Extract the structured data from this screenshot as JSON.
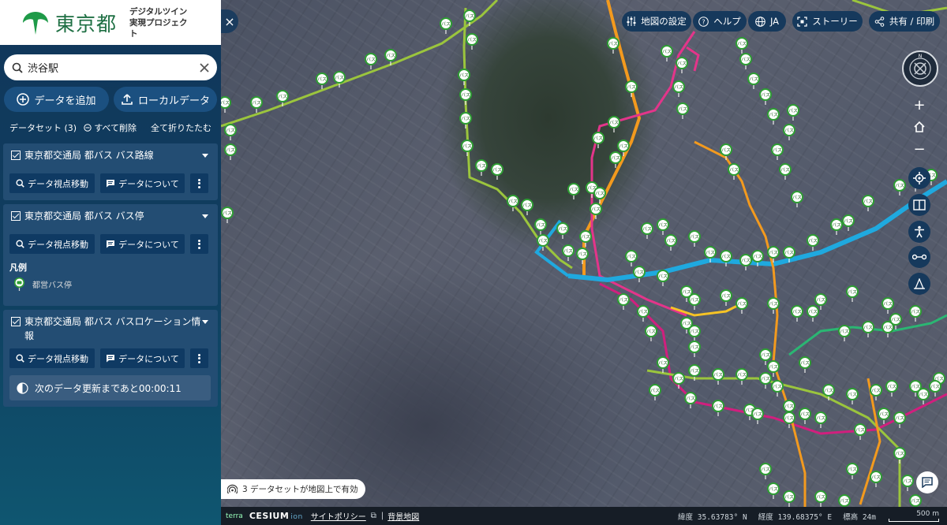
{
  "app": {
    "logo_text": "東京都",
    "logo_sub": "デジタルツイン 実現プロジェクト"
  },
  "search": {
    "value": "渋谷駅",
    "placeholder": ""
  },
  "buttons": {
    "add_data": "データを追加",
    "local_data": "ローカルデータ"
  },
  "datasets": {
    "label": "データセット (3)",
    "delete_all": "すべて削除",
    "collapse_all": "全て折りたたむ",
    "items": [
      {
        "title": "東京都交通局 都バス バス路線",
        "move": "データ視点移動",
        "about": "データについて"
      },
      {
        "title": "東京都交通局 都バス バス停",
        "move": "データ視点移動",
        "about": "データについて",
        "legend_title": "凡例",
        "legend_item": "都営バス停"
      },
      {
        "title": "東京都交通局 都バス バスロケーション情報",
        "move": "データ視点移動",
        "about": "データについて",
        "update_text": "次のデータ更新まであと00:00:11"
      }
    ]
  },
  "toolbar": {
    "map_settings": "地図の設定",
    "help": "ヘルプ",
    "language": "JA",
    "story": "ストーリー",
    "share": "共有 / 印刷"
  },
  "map": {
    "compass_north": "N",
    "stop_label": "バス",
    "toast": "3 データセットが地図上で有効"
  },
  "footer": {
    "terra": "terra",
    "cesium": "CESIUM",
    "cesium_sub": "ion",
    "site_policy": "サイトポリシー",
    "background_map": "背景地図",
    "lat_label": "緯度",
    "lat_value": "35.63783° N",
    "lon_label": "経度",
    "lon_value": "139.68375° E",
    "elev_label": "標高",
    "elev_value": "24m",
    "scale": "500 m"
  },
  "colors": {
    "route_green": "#9bc53d",
    "route_orange": "#f39a1e",
    "route_pink": "#e3358a",
    "route_blue": "#1fa9df",
    "route_magenta": "#d11f7e",
    "route_teal": "#2bb673",
    "route_yellow": "#f6c325",
    "stop_green": "#2e9e33"
  }
}
